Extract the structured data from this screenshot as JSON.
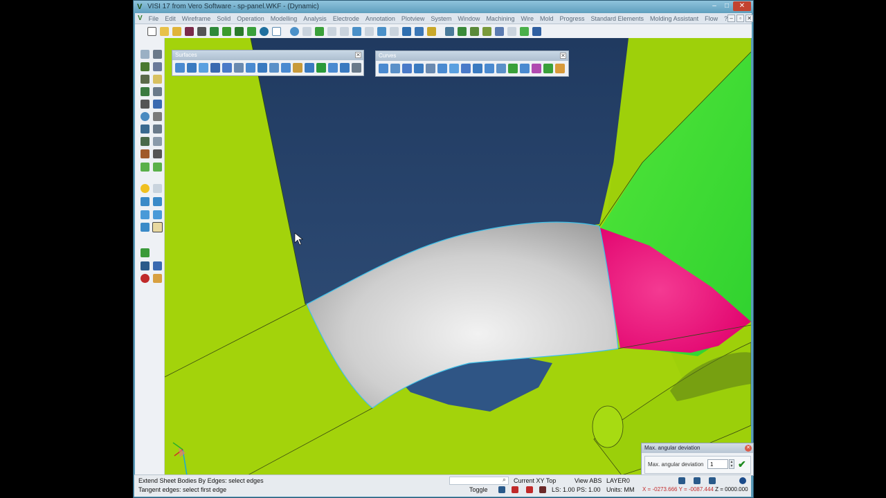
{
  "window": {
    "title": "VISI 17 from Vero Software - sp-panel.WKF - (Dynamic)",
    "app_icon": "visi-logo-icon",
    "controls": {
      "minimize": "–",
      "maximize": "□",
      "close": "✕"
    }
  },
  "menubar": {
    "items": [
      "File",
      "Edit",
      "Wireframe",
      "Solid",
      "Operation",
      "Modelling",
      "Analysis",
      "Electrode",
      "Annotation",
      "Plotview",
      "System",
      "Window",
      "Machining",
      "Wire",
      "Mold",
      "Progress",
      "Standard Elements",
      "Molding Assistant",
      "Flow",
      "?"
    ],
    "mdi_controls": [
      "–",
      "▫",
      "✕"
    ]
  },
  "panels": {
    "surfaces": {
      "title": "Surfaces",
      "close": "✕"
    },
    "curves": {
      "title": "Curves",
      "close": "✕"
    }
  },
  "dialog": {
    "title": "Max. angular deviation",
    "label": "Max. angular deviation",
    "value": "1",
    "ok_icon": "✔",
    "close_icon": "✕"
  },
  "status": {
    "line1": "Extend Sheet Bodies By Edges: select edges",
    "line2": "Tangent edges: select first edge",
    "search_icon": "⌕",
    "view_plane": "Current XY Top",
    "view_mode": "View ABS",
    "layer": "LAYER0",
    "toggle": "Toggle",
    "ls_ps": "LS: 1.00 PS: 1.00",
    "units": "Units: MM",
    "coords": "X = -0273.666 Y = -0087.444",
    "z": "Z = 0000.000"
  },
  "colors": {
    "model_green": "#a4d60c",
    "background_navy": "#2a4670",
    "selected_surface": "#d6d6d6",
    "pink_face": "#ea0f7c",
    "bright_green_face": "#3ce43c"
  }
}
